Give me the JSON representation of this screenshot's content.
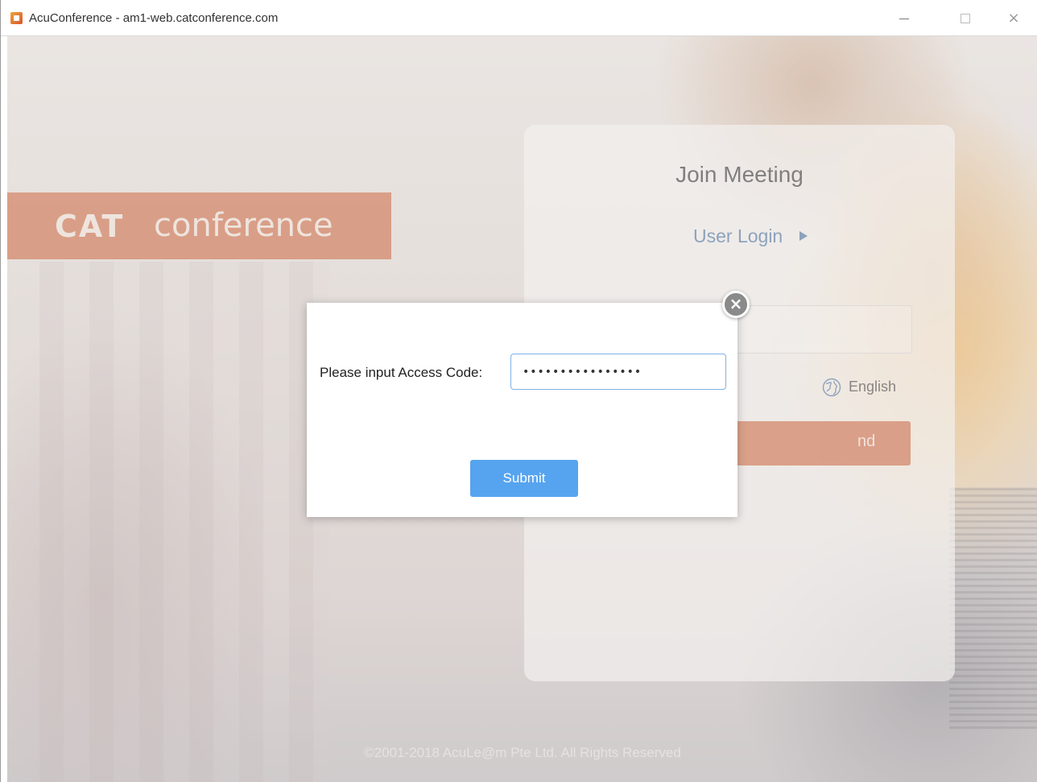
{
  "window": {
    "title": "AcuConference - am1-web.catconference.com",
    "app_icon": "acuconference-app-icon",
    "controls": [
      "minimize-icon",
      "maximize-icon",
      "close-icon"
    ],
    "close_glyph": "×"
  },
  "brand": {
    "logo_text_bold": "CAT",
    "logo_text": "conference",
    "color": "#c95a30"
  },
  "join_card": {
    "title": "Join Meeting",
    "user_login_label": "User Login",
    "language_label": "English",
    "attend_label_visible": "nd"
  },
  "footer": {
    "copyright": "©2001-2018 AcuLe@m Pte Ltd. All Rights Reserved"
  },
  "modal": {
    "close_glyph": "×",
    "access_code_label": "Please input Access Code:",
    "access_code_value": "••••••••••••••••",
    "submit_label": "Submit",
    "submit_color": "#56a4f0",
    "focus_border_color": "#7fb1e6"
  }
}
